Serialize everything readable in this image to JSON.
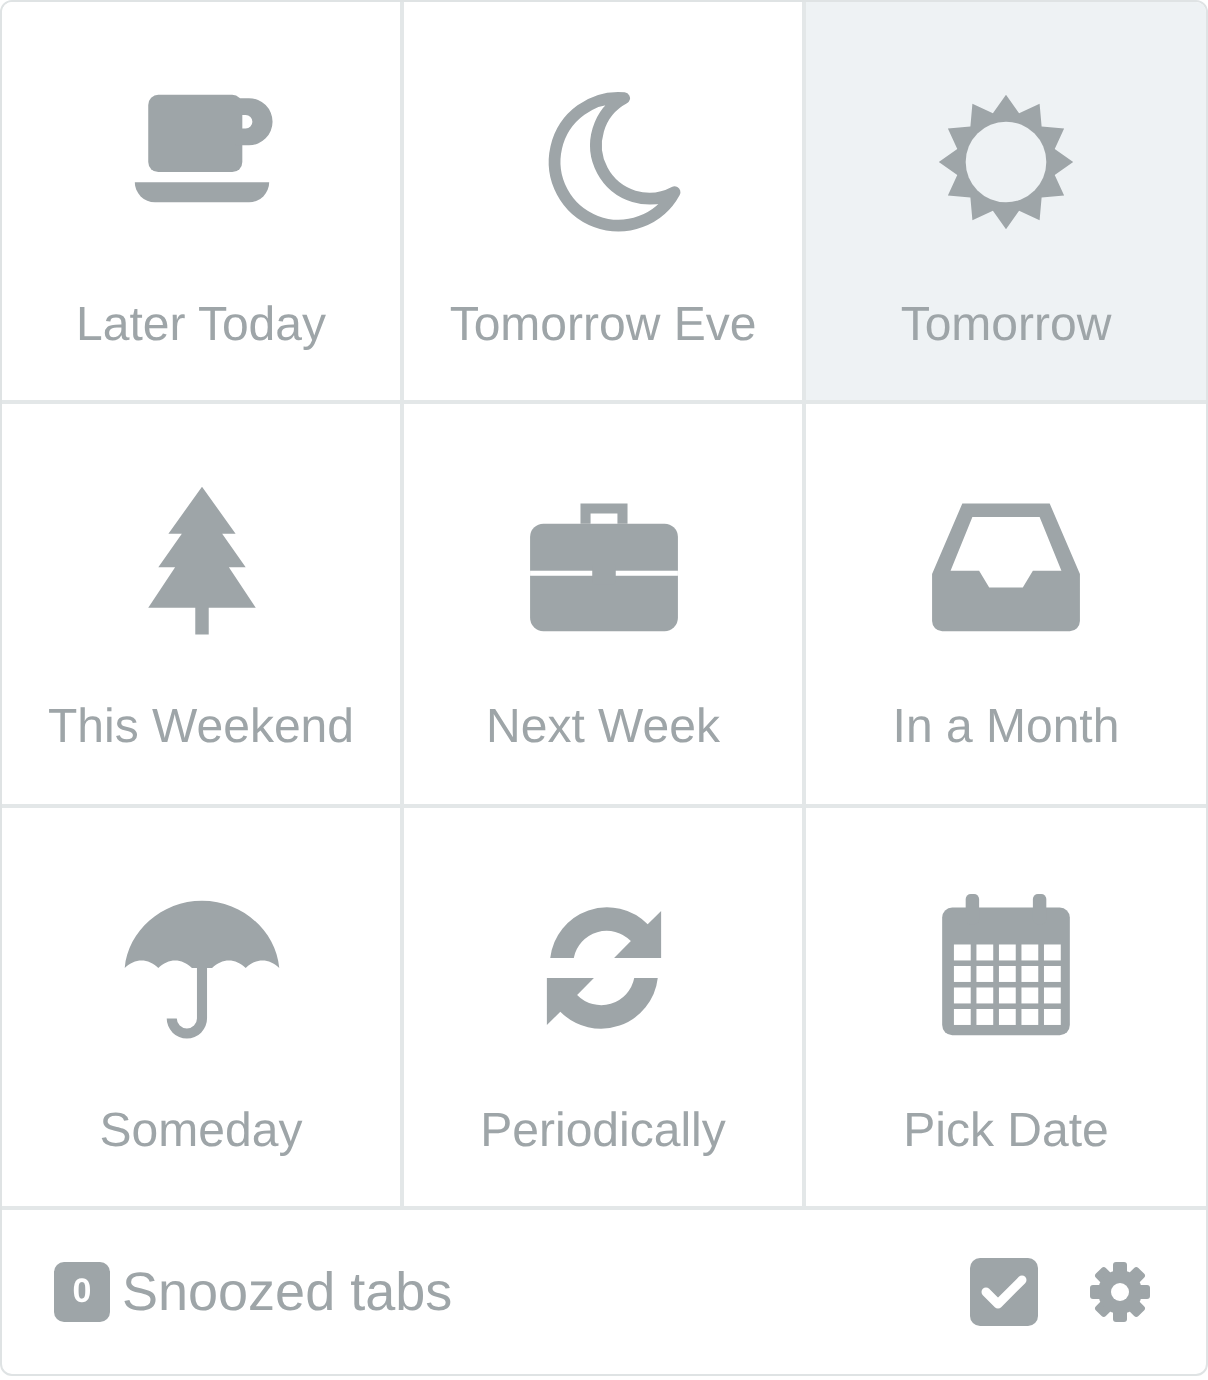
{
  "options": [
    {
      "label": "Later Today",
      "selected": false
    },
    {
      "label": "Tomorrow Eve",
      "selected": false
    },
    {
      "label": "Tomorrow",
      "selected": true
    },
    {
      "label": "This Weekend",
      "selected": false
    },
    {
      "label": "Next Week",
      "selected": false
    },
    {
      "label": "In a Month",
      "selected": false
    },
    {
      "label": "Someday",
      "selected": false
    },
    {
      "label": "Periodically",
      "selected": false
    },
    {
      "label": "Pick Date",
      "selected": false
    }
  ],
  "footer": {
    "count": "0",
    "label": "Snoozed tabs"
  }
}
